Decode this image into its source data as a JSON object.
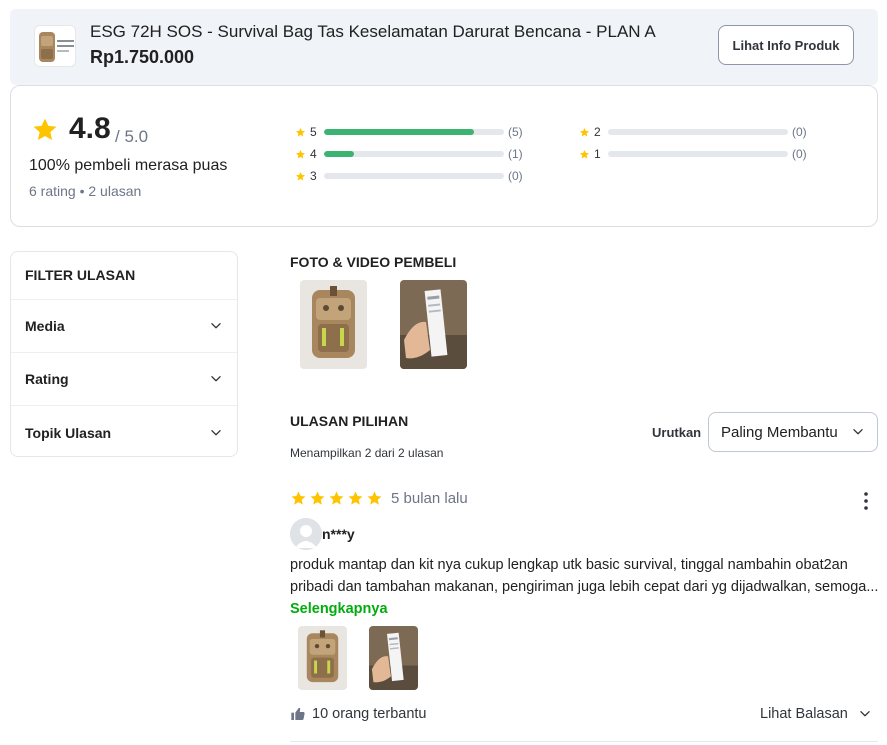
{
  "product": {
    "title": "ESG 72H SOS - Survival Bag Tas Keselamatan Darurat Bencana - PLAN A",
    "price": "Rp1.750.000",
    "info_button": "Lihat Info Produk",
    "thumb_icon": "backpack-icon"
  },
  "summary": {
    "score": "4.8",
    "score_max": "/ 5.0",
    "satisfied": "100% pembeli merasa puas",
    "counts": "6 rating • 2 ulasan",
    "breakdown": [
      {
        "stars": "5",
        "count": "(5)",
        "fraction": 0.833
      },
      {
        "stars": "4",
        "count": "(1)",
        "fraction": 0.167
      },
      {
        "stars": "3",
        "count": "(0)",
        "fraction": 0
      },
      {
        "stars": "2",
        "count": "(0)",
        "fraction": 0
      },
      {
        "stars": "1",
        "count": "(0)",
        "fraction": 0
      }
    ]
  },
  "filter": {
    "title": "FILTER ULASAN",
    "items": [
      {
        "label": "Media"
      },
      {
        "label": "Rating"
      },
      {
        "label": "Topik Ulasan"
      }
    ]
  },
  "media": {
    "title": "FOTO & VIDEO PEMBELI"
  },
  "reviews_section": {
    "title": "ULASAN PILIHAN",
    "showing": "Menampilkan 2 dari 2 ulasan",
    "sort_label": "Urutkan",
    "sort_value": "Paling Membantu"
  },
  "review": {
    "rating": 5,
    "time": "5 bulan lalu",
    "username": "n***y",
    "text": "produk mantap dan kit nya cukup lengkap utk basic survival, tinggal nambahin obat2an pribadi dan tambahan makanan, pengiriman juga lebih cepat dari yg dijadwalkan, semoga...",
    "more": "Selengkapnya",
    "helpful": "10 orang terbantu",
    "replies": "Lihat Balasan"
  },
  "colors": {
    "star": "#ffc400",
    "accent_green": "#03ac0e",
    "bar_fill": "#3cb371",
    "header_bg": "#f0f3f7"
  }
}
